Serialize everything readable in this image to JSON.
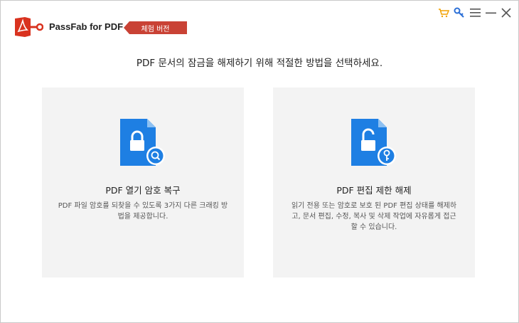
{
  "app": {
    "title": "PassFab for PDF",
    "trial_badge": "체험 버전",
    "brand_color": "#d9321f",
    "badge_color": "#c94235"
  },
  "controls": [
    {
      "name": "cart-icon",
      "color": "#f2a100"
    },
    {
      "name": "key-icon",
      "color": "#2b6fd6"
    },
    {
      "name": "menu-icon",
      "color": "#555555"
    },
    {
      "name": "minimize-icon",
      "color": "#555555"
    },
    {
      "name": "close-icon",
      "color": "#555555"
    }
  ],
  "instruction": "PDF 문서의 잠금을 해제하기 위해 적절한 방법을 선택하세요.",
  "cards": [
    {
      "title": "PDF 열기 암호 복구",
      "description": "PDF 파일 암호를 되찾을 수 있도록 3가지 다른 크래킹 방법을 제공합니다.",
      "icon": "locked-document-search-icon",
      "icon_color": "#1e7fe3"
    },
    {
      "title": "PDF 편집 제한 해제",
      "description": "읽기 전용 또는 암호로 보호 된 PDF 편집 상태를 해제하고, 문서 편집, 수정, 복사 및 삭제 작업에 자유롭게 접근 할 수 있습니다.",
      "icon": "unlocked-document-key-icon",
      "icon_color": "#1e7fe3"
    }
  ]
}
